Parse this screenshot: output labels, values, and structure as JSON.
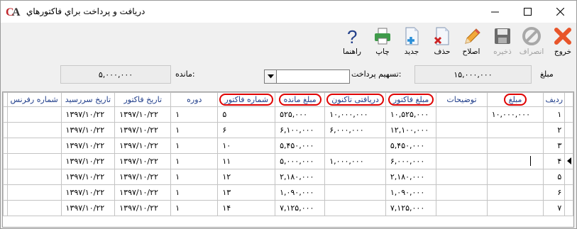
{
  "window": {
    "title": "دریافت و پرداخت براي فاكتورهاي",
    "icon": "app-logo-icon"
  },
  "toolbar": {
    "exit": "خروج",
    "cancel": "انصراف",
    "save": "ذخیره",
    "edit": "اصلاح",
    "delete": "حذف",
    "new": "جدید",
    "print": "چاپ",
    "help": "راهنما"
  },
  "form": {
    "amount_label": "مبلغ",
    "amount_value": "۱۵,۰۰۰,۰۰۰",
    "distribution_label": "تسهیم پرداخت:",
    "distribution_value": "",
    "remaining_label": "مانده:",
    "remaining_value": "۵,۰۰۰,۰۰۰"
  },
  "grid": {
    "columns": [
      "ردیف",
      "مبلغ",
      "توضیحات",
      "مبلغ فاكتور",
      "دریافتی تاكنون",
      "مبلغ مانده",
      "شماره فاكتور",
      "دوره",
      "تاریخ فاكتور",
      "تاریخ سررسید",
      "شماره رفرنس"
    ],
    "highlighted_columns": [
      "مبلغ",
      "مبلغ فاكتور",
      "دریافتی تاكنون",
      "مبلغ مانده",
      "شماره فاكتور"
    ],
    "current_row": 4,
    "rows": [
      [
        "۱",
        "۱۰,۰۰۰,۰۰۰",
        "",
        "۱۰,۵۲۵,۰۰۰",
        "۱۰,۰۰۰,۰۰۰",
        "۵۲۵,۰۰۰",
        "۵",
        "۱",
        "۱۳۹۷/۱۰/۲۲",
        "۱۳۹۷/۱۰/۲۲",
        ""
      ],
      [
        "۲",
        "",
        "",
        "۱۲,۱۰۰,۰۰۰",
        "۶,۰۰۰,۰۰۰",
        "۶,۱۰۰,۰۰۰",
        "۶",
        "۱",
        "۱۳۹۷/۱۰/۲۲",
        "۱۳۹۷/۱۰/۲۲",
        ""
      ],
      [
        "۳",
        "",
        "",
        "۵,۴۵۰,۰۰۰",
        "",
        "۵,۴۵۰,۰۰۰",
        "۱۰",
        "۱",
        "۱۳۹۷/۱۰/۲۲",
        "۱۳۹۷/۱۰/۲۲",
        ""
      ],
      [
        "۴",
        "",
        "",
        "۶,۰۰۰,۰۰۰",
        "۱,۰۰۰,۰۰۰",
        "۵,۰۰۰,۰۰۰",
        "۱۱",
        "۱",
        "۱۳۹۷/۱۰/۲۲",
        "۱۳۹۷/۱۰/۲۲",
        ""
      ],
      [
        "۵",
        "",
        "",
        "۲,۱۸۰,۰۰۰",
        "",
        "۲,۱۸۰,۰۰۰",
        "۱۲",
        "۱",
        "۱۳۹۷/۱۰/۲۲",
        "۱۳۹۷/۱۰/۲۲",
        ""
      ],
      [
        "۶",
        "",
        "",
        "۱,۰۹۰,۰۰۰",
        "",
        "۱,۰۹۰,۰۰۰",
        "۱۳",
        "۱",
        "۱۳۹۷/۱۰/۲۲",
        "۱۳۹۷/۱۰/۲۲",
        ""
      ],
      [
        "۷",
        "",
        "",
        "۷,۱۲۵,۰۰۰",
        "",
        "۷,۱۲۵,۰۰۰",
        "۱۴",
        "۱",
        "۱۳۹۷/۱۰/۲۲",
        "۱۳۹۷/۱۰/۲۲",
        ""
      ]
    ]
  },
  "colors": {
    "header_text": "#1f3d8a",
    "highlight_border": "#e00000",
    "exit_icon": "#e8552a",
    "save_icon": "#6b6b6b"
  }
}
